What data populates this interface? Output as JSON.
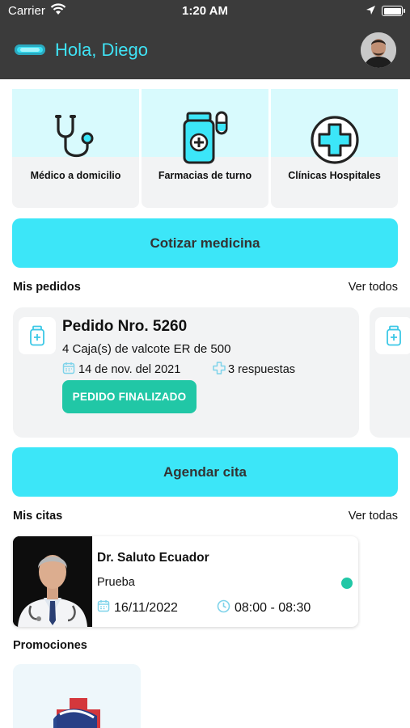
{
  "status_bar": {
    "carrier": "Carrier",
    "time": "1:20 AM"
  },
  "header": {
    "greeting": "Hola, Diego",
    "icons": [
      "app-logo",
      "user-avatar"
    ]
  },
  "categories": [
    {
      "label": "Médico a domicilio",
      "icon": "stethoscope-icon"
    },
    {
      "label": "Farmacias de turno",
      "icon": "pharmacy-bottle-icon"
    },
    {
      "label": "Clínicas Hospitales",
      "icon": "medical-cross-icon"
    }
  ],
  "quote_button": "Cotizar medicina",
  "orders": {
    "title": "Mis pedidos",
    "see_all": "Ver todos",
    "items": [
      {
        "title": "Pedido Nro. 5260",
        "description": "4 Caja(s) de valcote ER de 500",
        "date": "14 de nov. del 2021",
        "responses": "3 respuestas",
        "status": "PEDIDO FINALIZADO"
      }
    ]
  },
  "schedule_button": "Agendar cita",
  "appointments": {
    "title": "Mis citas",
    "see_all": "Ver todas",
    "items": [
      {
        "doctor": "Dr. Saluto Ecuador",
        "note": "Prueba",
        "date": "16/11/2022",
        "time": "08:00 - 08:30"
      }
    ]
  },
  "promotions": {
    "title": "Promociones"
  },
  "colors": {
    "header_bg": "#3b3b3b",
    "accent_cyan": "#3ce6f8",
    "status_green": "#21c7a6",
    "card_bg": "#f2f3f4"
  }
}
